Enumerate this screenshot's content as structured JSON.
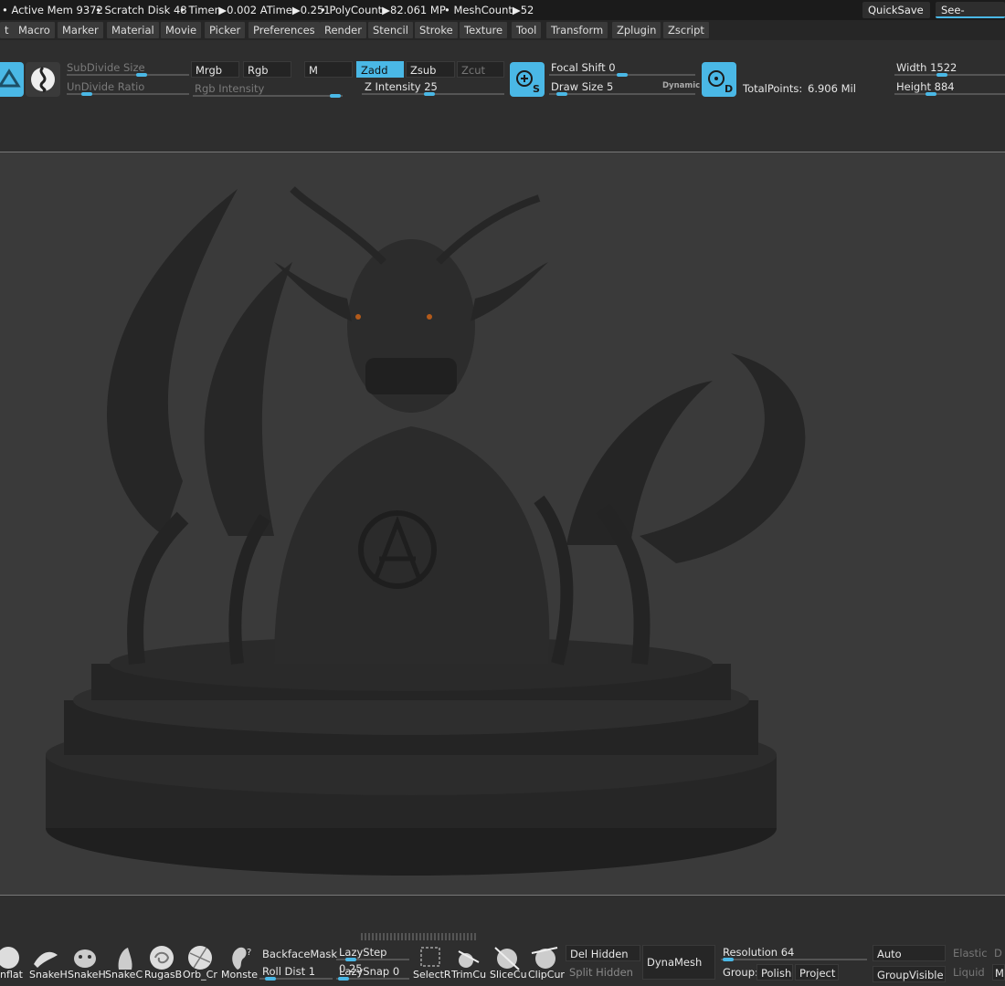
{
  "status": {
    "active_mem": "• Active Mem 9372",
    "scratch": "• Scratch Disk 48",
    "timer": "• Timer▶0.002 ATime▶0.251",
    "poly": "• PolyCount▶82.061 MP",
    "mesh": "• MeshCount▶52",
    "quicksave": "QuickSave",
    "seethrough": "See-through"
  },
  "menus": [
    "t",
    "Macro",
    "Marker",
    "Material",
    "Movie",
    "Picker",
    "Preferences",
    "Render",
    "Stencil",
    "Stroke",
    "Texture",
    "Tool",
    "Transform",
    "Zplugin",
    "Zscript"
  ],
  "toolbar": {
    "subdivide_size": "SubDivide Size",
    "undivide_ratio": "UnDivide Ratio",
    "mrgb": "Mrgb",
    "rgb": "Rgb",
    "m": "M",
    "rgb_intensity": "Rgb Intensity",
    "zadd": "Zadd",
    "zsub": "Zsub",
    "zcut": "Zcut",
    "z_intensity": "Z Intensity 25",
    "focal_shift": "Focal Shift 0",
    "draw_size": "Draw Size 5",
    "dynamic": "Dynamic",
    "total_points_label": "TotalPoints:",
    "total_points_value": "6.906 Mil",
    "width": "Width 1522",
    "height": "Height 884",
    "s_label": "S",
    "d_label": "D"
  },
  "bottom": {
    "brushes": [
      "nflat",
      "SnakeH",
      "SnakeH",
      "SnakeC",
      "RugasB",
      "Orb_Cr",
      "Monste"
    ],
    "backface": "BackfaceMask",
    "roll_dist": "Roll Dist 1",
    "lazystep": "LazyStep 0.25",
    "lazysnap": "LazySnap 0",
    "select": "SelectR",
    "trim": "TrimCu",
    "slice": "SliceCu",
    "clip": "ClipCur",
    "del_hidden": "Del Hidden",
    "split_hidden": "Split Hidden",
    "dynamesh": "DynaMesh",
    "resolution": "Resolution 64",
    "group": "Group:",
    "polish": "Polish",
    "project": "Project",
    "auto_groups": "Auto Groups",
    "group_visible": "GroupVisible",
    "elastic": "Elastic",
    "liquid": "Liquid",
    "d_cut": "D",
    "m_cut": "M"
  },
  "colors": {
    "accent": "#4ab8e6",
    "bg": "#2e2e2e",
    "canvas": "#3a3a3a"
  }
}
